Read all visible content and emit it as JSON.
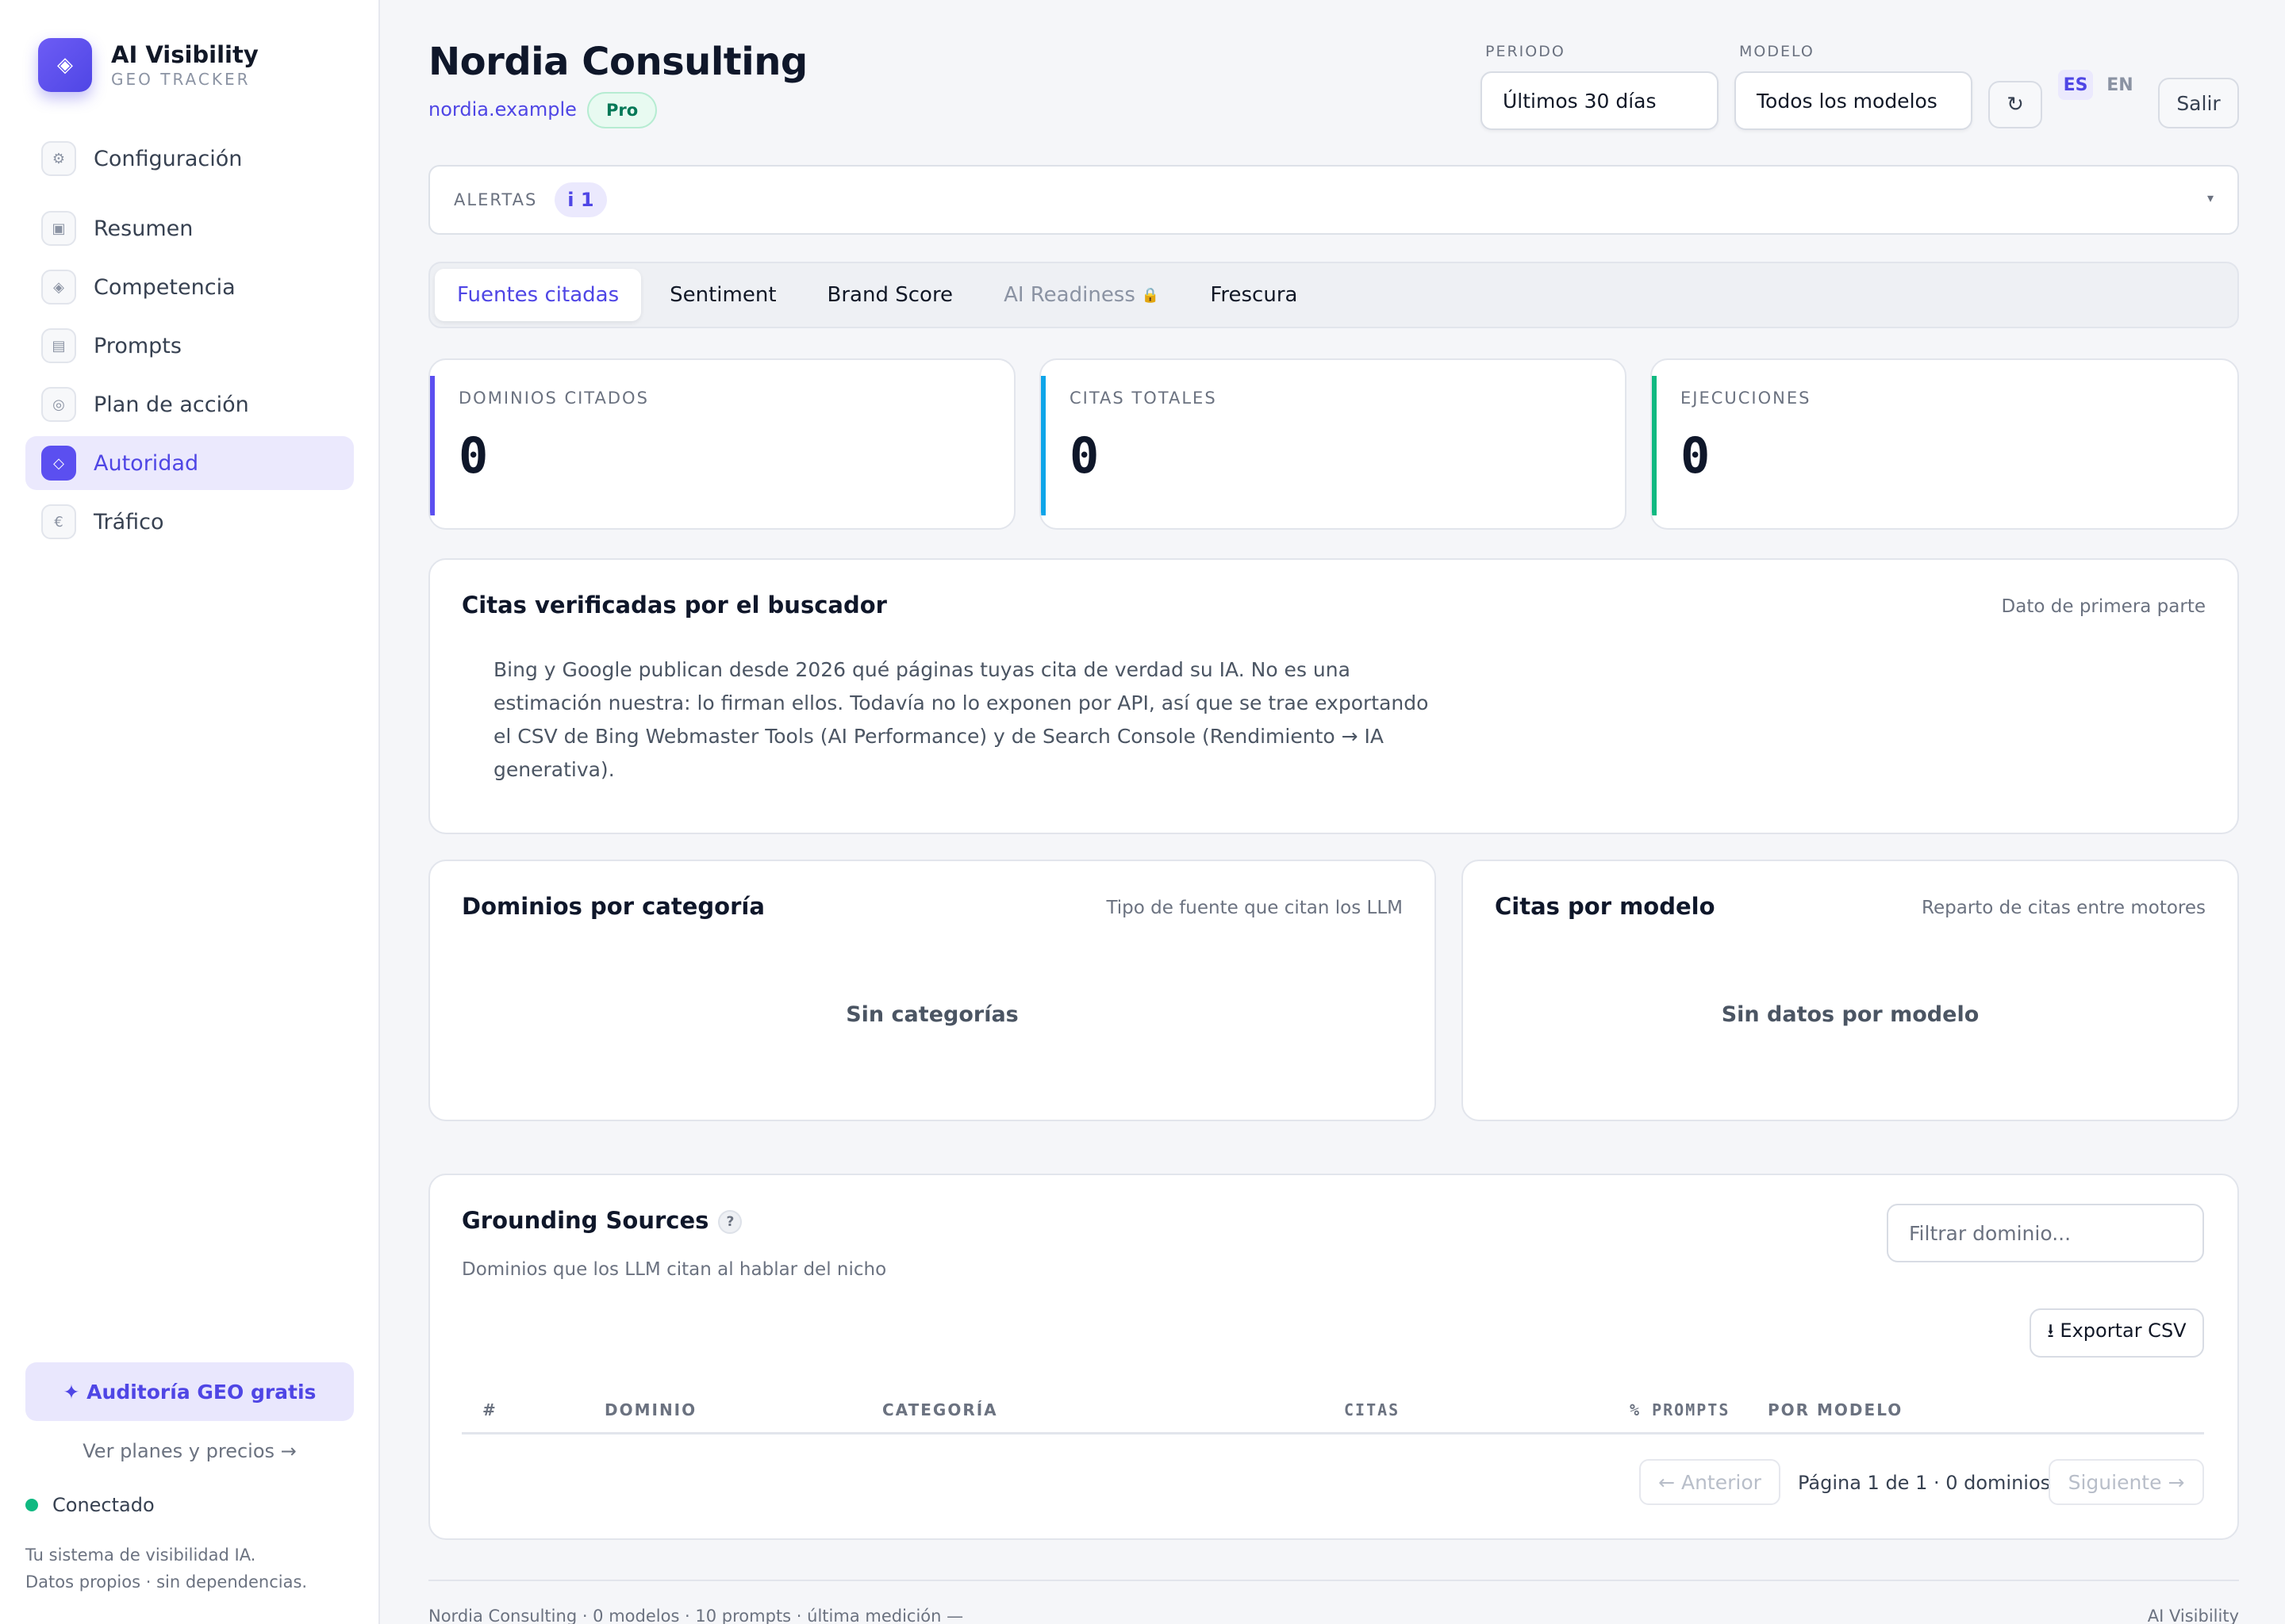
{
  "brand": {
    "title": "AI Visibility",
    "subtitle": "GEO TRACKER",
    "logo_icon": "diamond-icon"
  },
  "nav": [
    {
      "label": "Configuración",
      "icon": "gear-icon",
      "active": false
    },
    {
      "label": "Resumen",
      "icon": "square-icon",
      "active": false
    },
    {
      "label": "Competencia",
      "icon": "diamond-icon",
      "active": false
    },
    {
      "label": "Prompts",
      "icon": "list-icon",
      "active": false
    },
    {
      "label": "Plan de acción",
      "icon": "target-icon",
      "active": false
    },
    {
      "label": "Autoridad",
      "icon": "diamond-icon",
      "active": true
    },
    {
      "label": "Tráfico",
      "icon": "euro-icon",
      "active": false
    }
  ],
  "sidebar_footer": {
    "audit_button": "✦ Auditoría GEO gratis",
    "plans_link": "Ver planes y precios →",
    "status": "Conectado",
    "tagline_line1": "Tu sistema de visibilidad IA.",
    "tagline_line2": "Datos propios · sin dependencias."
  },
  "header": {
    "title": "Nordia Consulting",
    "domain": "nordia.example",
    "plan": "Pro",
    "period_label": "PERIODO",
    "period_value": "Últimos 30 días",
    "model_label": "MODELO",
    "model_value": "Todos los modelos",
    "refresh_icon": "↻",
    "lang_es": "ES",
    "lang_en": "EN",
    "logout": "Salir"
  },
  "alerts": {
    "label": "ALERTAS",
    "badge": "i 1",
    "caret": "▾"
  },
  "tabs": [
    {
      "label": "Fuentes citadas",
      "state": "active"
    },
    {
      "label": "Sentiment",
      "state": "normal"
    },
    {
      "label": "Brand Score",
      "state": "normal"
    },
    {
      "label": "AI Readiness",
      "state": "disabled",
      "lock": "🔒"
    },
    {
      "label": "Frescura",
      "state": "normal"
    }
  ],
  "stats": [
    {
      "label": "DOMINIOS CITADOS",
      "value": "0",
      "color": "#5b4ff0"
    },
    {
      "label": "CITAS TOTALES",
      "value": "0",
      "color": "#0ea5e9"
    },
    {
      "label": "EJECUCIONES",
      "value": "0",
      "color": "#10b981"
    }
  ],
  "verified": {
    "title": "Citas verificadas por el buscador",
    "note": "Dato de primera parte",
    "body": "Bing y Google publican desde 2026 qué páginas tuyas cita de verdad su IA. No es una estimación nuestra: lo firman ellos. Todavía no lo exponen por API, así que se trae exportando el CSV de Bing Webmaster Tools (AI Performance) y de Search Console (Rendimiento → IA generativa)."
  },
  "categories_card": {
    "title": "Dominios por categoría",
    "note": "Tipo de fuente que citan los LLM",
    "empty": "Sin categorías"
  },
  "models_card": {
    "title": "Citas por modelo",
    "note": "Reparto de citas entre motores",
    "empty": "Sin datos por modelo"
  },
  "grounding": {
    "title": "Grounding Sources",
    "help": "?",
    "subtitle": "Dominios que los LLM citan al hablar del nicho",
    "filter_placeholder": "Filtrar dominio...",
    "export": "⭳ Exportar CSV",
    "columns": [
      "#",
      "DOMINIO",
      "CATEGORÍA",
      "CITAS",
      "% PROMPTS",
      "POR MODELO"
    ],
    "rows": [],
    "prev": "← Anterior",
    "page_info": "Página 1 de 1 · 0 dominios",
    "next": "Siguiente →"
  },
  "footer": {
    "left": "Nordia Consulting · 0 modelos · 10 prompts · última medición —",
    "right": "AI Visibility"
  }
}
